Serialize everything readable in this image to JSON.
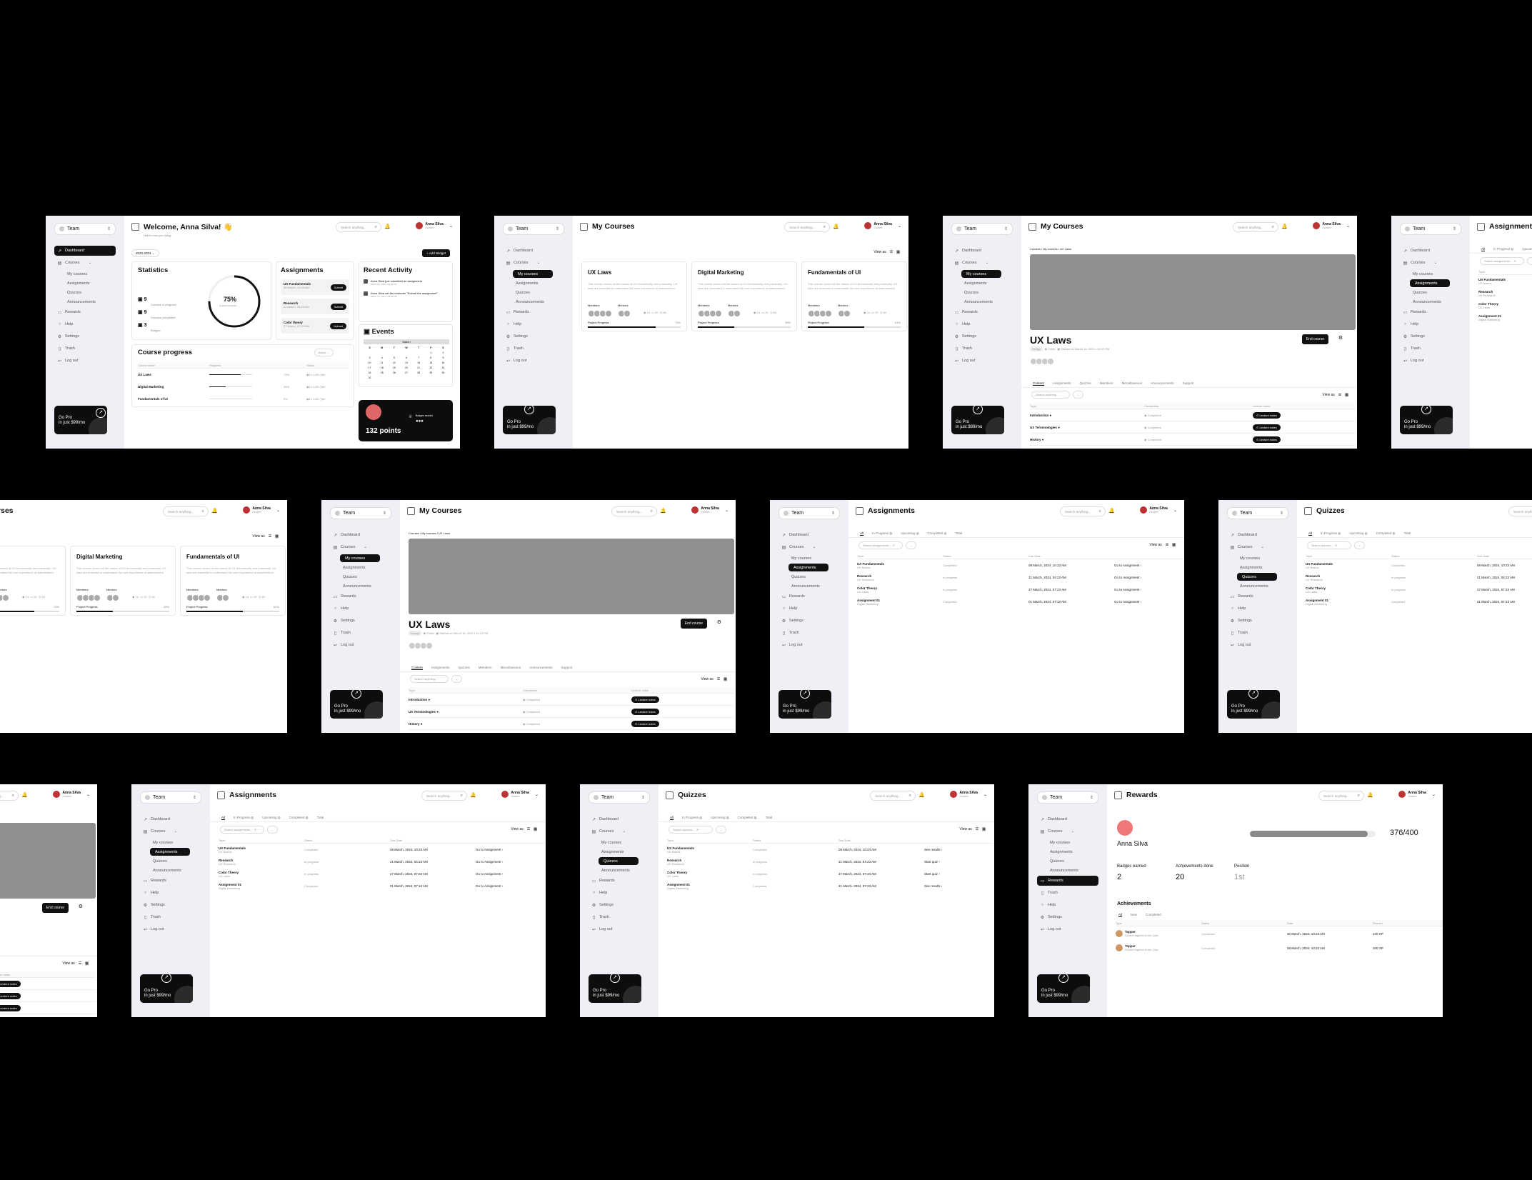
{
  "common": {
    "team": "Team",
    "search": "Search anything...",
    "user_name": "Anna Silva",
    "user_role": "Student",
    "gopro_1": "Go Pro",
    "gopro_2": "in just $99/mo"
  },
  "nav": {
    "dashboard": "Dashboard",
    "courses": "Courses",
    "my_courses": "My courses",
    "assignments": "Assignments",
    "quizzes": "Quizzes",
    "announcements": "Announcements",
    "rewards": "Rewards",
    "help": "Help",
    "settings": "Settings",
    "trash": "Trash",
    "logout": "Log out"
  },
  "dashboard": {
    "title": "Welcome, Anna Silva! 👋",
    "subtitle": "Here's how you doing",
    "year": "2023-2024",
    "add_widget": "+ Add Widget",
    "stats_title": "Statistics",
    "s1": "9",
    "s1l": "Courses in progress",
    "s2": "9",
    "s2l": "Courses completed",
    "s3": "3",
    "s3l": "Badges",
    "ring": "75%",
    "ring_sub": "Overall completion",
    "assign_title": "Assignments",
    "assign": [
      {
        "t": "UX Fundamentals",
        "d": "08 March, 10:23 AM",
        "b": "Submit"
      },
      {
        "t": "Research",
        "d": "21 March, 04:23 AM",
        "b": "Submit"
      },
      {
        "t": "Color theory",
        "d": "27 March, 07:23 AM",
        "b": "Upload"
      }
    ],
    "activity_title": "Recent Activity",
    "activity": [
      {
        "t": "Anna Silva just submitted an assignment",
        "d": "March 13, 2024 • 09:23 PM"
      },
      {
        "t": "Anna Silva set the reminder \"Submit the assignment\"",
        "d": "March 13, 2024 • 09:23 PM"
      }
    ],
    "events_title": "Events",
    "month": "March",
    "days": [
      "S",
      "M",
      "T",
      "W",
      "T",
      "F",
      "S"
    ],
    "dates": [
      "",
      "",
      "",
      "",
      "",
      "1",
      "2",
      "3",
      "4",
      "5",
      "6",
      "7",
      "8",
      "9",
      "10",
      "11",
      "12",
      "13",
      "14",
      "15",
      "16",
      "17",
      "18",
      "19",
      "20",
      "21",
      "22",
      "23",
      "24",
      "25",
      "26",
      "27",
      "28",
      "29",
      "30",
      "31"
    ],
    "cp_title": "Course progress",
    "cp_filter": "Active",
    "cp_cols": [
      "Course name",
      "Progress",
      "Status"
    ],
    "cp_rows": [
      {
        "n": "UX Laws",
        "p": "73%",
        "v": 0.73
      },
      {
        "n": "Digital Marketing",
        "p": "39%",
        "v": 0.39
      },
      {
        "n": "Fundamentals of UI",
        "p": "0%",
        "v": 0.0
      }
    ],
    "points": "132 points",
    "badges_earned": "Badges earned"
  },
  "courses": {
    "title": "My Courses",
    "view_as": "View as",
    "items": [
      {
        "t": "UX Laws",
        "p": "73%",
        "v": 0.73
      },
      {
        "t": "Digital Marketing",
        "p": "39%",
        "v": 0.39
      },
      {
        "t": "Fundamentals of UI",
        "p": "61%",
        "v": 0.61
      }
    ],
    "desc": "This course covers all the basics of UX theoretically and practically. UX laws are essential to understand the user experience of stakeholders.",
    "members": "Members",
    "mentors": "Mentors",
    "progress_label": "Project Progress",
    "m1": "14",
    "m2": "20",
    "m3": "60"
  },
  "detail": {
    "crumb": "Courses / My courses / UX Laws",
    "title": "UX Laws",
    "end_course": "End course",
    "chip": "Design",
    "public": "Public",
    "started": "Started on March 16, 2023 • 10:23 PM",
    "tabs": [
      "Content",
      "Assignments",
      "Quizzes",
      "Members",
      "Miscellaneous",
      "Announcements",
      "Support"
    ],
    "search": "Search anything...",
    "cols": [
      "Topic",
      "Completion",
      "Lecture notes"
    ],
    "rows": [
      {
        "t": "Introduction",
        "s": "Completed",
        "b": "Lecture notes"
      },
      {
        "t": "UX Terminologies",
        "s": "Completed",
        "b": "Lecture notes"
      },
      {
        "t": "History",
        "s": "Completed",
        "b": "Lecture notes"
      }
    ]
  },
  "assignments": {
    "title": "Assignments",
    "tabs": [
      "All",
      "In Progress",
      "Upcoming",
      "Completed",
      "Total"
    ],
    "search": "Search assignments...",
    "cols": [
      "Topic",
      "Status",
      "Due Date"
    ],
    "rows": [
      {
        "t": "UX Fundamentals",
        "s2": "UX Basics",
        "st": "Completed",
        "d": "08 March, 2024, 10:23 AM",
        "a": "Go to Assignment"
      },
      {
        "t": "Research",
        "s2": "UX Research",
        "st": "In progress",
        "d": "21 March, 2024, 04:23 AM",
        "a": "Go to Assignment"
      },
      {
        "t": "Color Theory",
        "s2": "UX Laws",
        "st": "In progress",
        "d": "27 March, 2024, 07:23 AM",
        "a": "Go to Assignment"
      },
      {
        "t": "Assignment 01",
        "s2": "Digital Marketing",
        "st": "Completed",
        "d": "01 March, 2024, 07:13 AM",
        "a": "Go to Assignment"
      }
    ]
  },
  "quizzes": {
    "title": "Quizzes",
    "search": "Search quizzes...",
    "rows": [
      {
        "t": "UX Fundamentals",
        "s2": "UX Basics",
        "st": "Completed",
        "d": "08 March, 2024, 10:23 AM",
        "a": "See results"
      },
      {
        "t": "Research",
        "s2": "UX Research",
        "st": "In progress",
        "d": "21 March, 2024, 04:23 AM",
        "a": "Start quiz"
      },
      {
        "t": "Color Theory",
        "s2": "UX Laws",
        "st": "In progress",
        "d": "27 March, 2024, 07:23 AM",
        "a": "Start quiz"
      },
      {
        "t": "Assignment 01",
        "s2": "Digital Marketing",
        "st": "Completed",
        "d": "21 March, 2024, 07:23 AM",
        "a": "See results"
      }
    ]
  },
  "rewards": {
    "title": "Rewards",
    "name": "Anna Silva",
    "score": "376/400",
    "score_v": 0.94,
    "k1": "Badges earned",
    "v1": "2",
    "k2": "Achievements done",
    "v2": "20",
    "k3": "Position",
    "v3": "1st",
    "ach_title": "Achievements",
    "tabs": [
      "All",
      "New",
      "Completed"
    ],
    "cols": [
      "Type",
      "Status",
      "Date",
      "Reward"
    ],
    "rows": [
      {
        "t": "Topper",
        "s": "Scored highest in the Quiz",
        "st": "Completed",
        "d": "30 March, 2024, 10:23 AM",
        "r": "100 XP"
      },
      {
        "t": "Topper",
        "s": "Scored highest in the Quiz",
        "st": "Completed",
        "d": "08 March, 2024, 10:23 AM",
        "r": "100 XP"
      }
    ]
  }
}
